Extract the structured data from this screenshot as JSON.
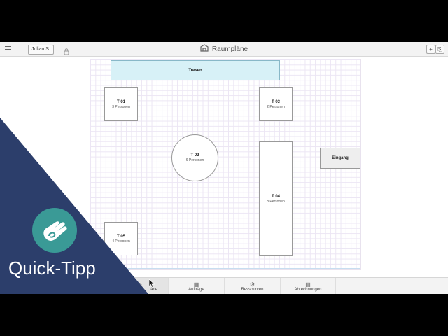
{
  "topbar": {
    "user_label": "Julian S.",
    "title": "Raumpläne",
    "add_label": "+",
    "export_label": "⎘"
  },
  "canvas": {
    "tresen": "Tresen",
    "eingang": "Eingang",
    "tables": [
      {
        "id": "T 01",
        "capacity": "3 Personen"
      },
      {
        "id": "T 02",
        "capacity": "6 Personen"
      },
      {
        "id": "T 03",
        "capacity": "2 Personen"
      },
      {
        "id": "T 04",
        "capacity": "8 Personen"
      },
      {
        "id": "T 05",
        "capacity": "4 Personen"
      }
    ]
  },
  "tabs": [
    {
      "label": "Raumpläne",
      "visible_label": "läne",
      "icon": "floorplan-icon",
      "active": true
    },
    {
      "label": "Aufträge",
      "icon": "orders-icon",
      "active": false
    },
    {
      "label": "Ressourcen",
      "icon": "resources-icon",
      "active": false
    },
    {
      "label": "Abrechnungen",
      "icon": "invoice-icon",
      "active": false
    }
  ],
  "banner": {
    "text": "Quick-Tipp",
    "background": "#2c3e6b",
    "accent": "#3a9a96"
  }
}
